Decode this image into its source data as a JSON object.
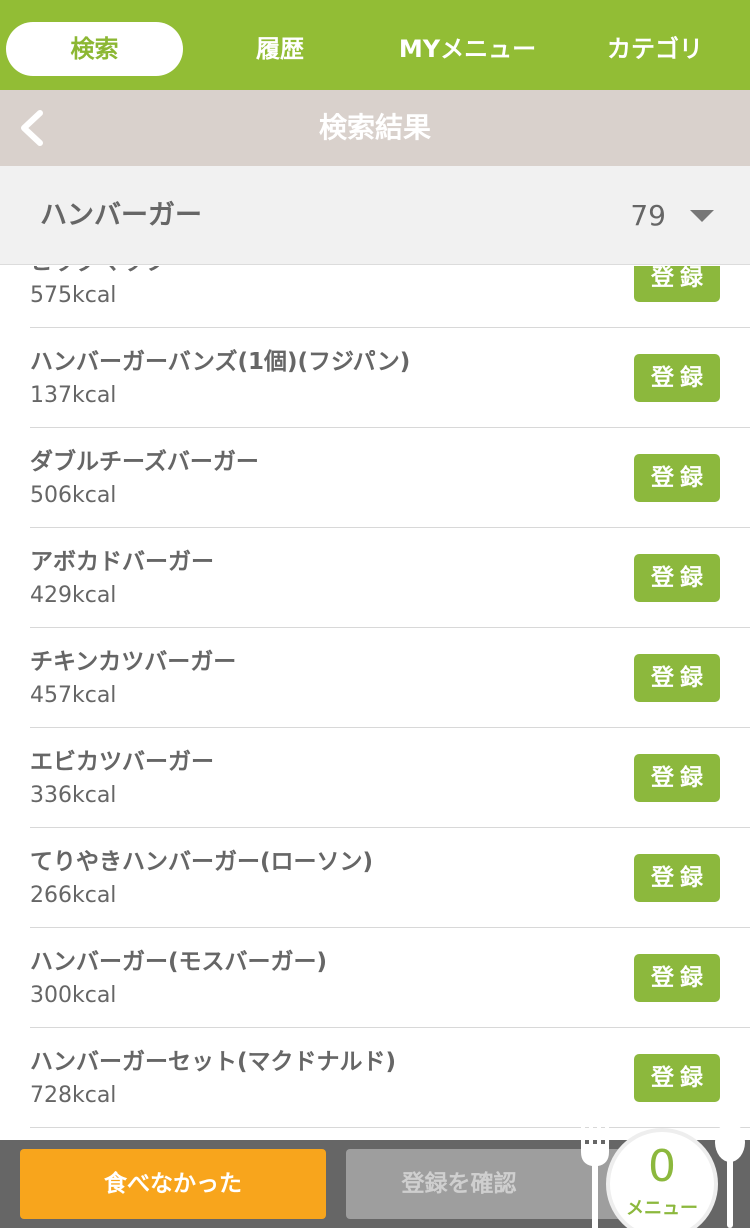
{
  "tabs": [
    {
      "label": "検索",
      "active": true
    },
    {
      "label": "履歴",
      "active": false
    },
    {
      "label": "MYメニュー",
      "active": false
    },
    {
      "label": "カテゴリ",
      "active": false
    }
  ],
  "header": {
    "title": "検索結果",
    "back_icon": "chevron-left-icon"
  },
  "search": {
    "query": "ハンバーガー",
    "count": "79",
    "dropdown_icon": "caret-down-icon"
  },
  "results": {
    "register_label": "登録",
    "items": [
      {
        "name": "ビッグマック",
        "kcal": "575kcal"
      },
      {
        "name": "ハンバーガーバンズ(1個)(フジパン)",
        "kcal": "137kcal"
      },
      {
        "name": "ダブルチーズバーガー",
        "kcal": "506kcal"
      },
      {
        "name": "アボカドバーガー",
        "kcal": "429kcal"
      },
      {
        "name": "チキンカツバーガー",
        "kcal": "457kcal"
      },
      {
        "name": "エビカツバーガー",
        "kcal": "336kcal"
      },
      {
        "name": "てりやきハンバーガー(ローソン)",
        "kcal": "266kcal"
      },
      {
        "name": "ハンバーガー(モスバーガー)",
        "kcal": "300kcal"
      },
      {
        "name": "ハンバーガーセット(マクドナルド)",
        "kcal": "728kcal"
      },
      {
        "name": "",
        "kcal": ""
      }
    ]
  },
  "footer": {
    "didnt_eat_label": "食べなかった",
    "confirm_label": "登録を確認",
    "menu_count": "0",
    "menu_label": "メニュー"
  },
  "colors": {
    "brand_green": "#92bd35",
    "button_green": "#8cb83d",
    "orange": "#f8a51c",
    "title_bar": "#d9d1cc"
  }
}
